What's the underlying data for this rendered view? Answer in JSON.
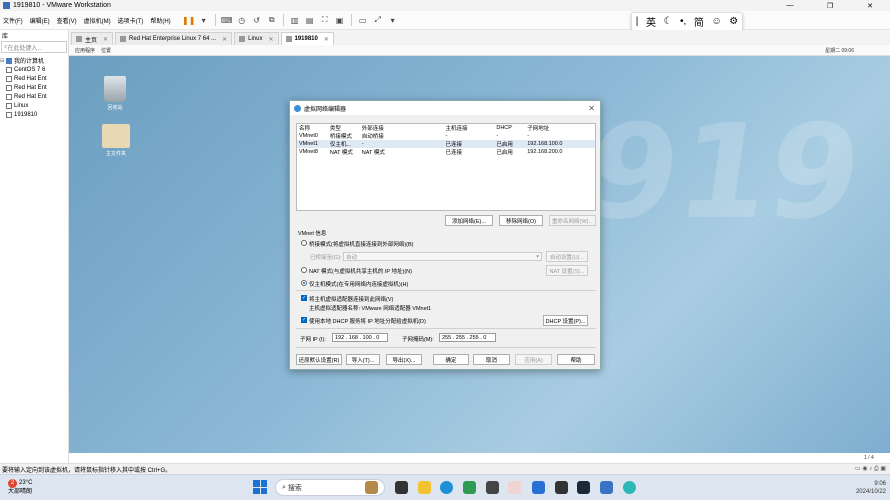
{
  "window": {
    "title": "1919810 - VMware Workstation",
    "controls": [
      "—",
      "❐",
      "✕"
    ]
  },
  "menu": {
    "items": [
      "文件(F)",
      "编辑(E)",
      "查看(V)",
      "虚拟机(M)",
      "选项卡(T)",
      "帮助(H)"
    ]
  },
  "ime": {
    "mode": "英",
    "simplified": "简"
  },
  "library": {
    "header": "库",
    "search_placeholder": "在此处键入...",
    "root": "我的计算机",
    "vms": [
      "CentOS 7 6",
      "Red Hat Ent",
      "Red Hat Ent",
      "Red Hat Ent",
      "Linux",
      "1919810"
    ]
  },
  "tabs": [
    {
      "label": "主页"
    },
    {
      "label": "Red Hat Enterprise Linux 7 64 ..."
    },
    {
      "label": "Linux"
    },
    {
      "label": "1919810"
    }
  ],
  "guestbar": {
    "apps": "应用程序",
    "places": "位置",
    "clock": "星期二 09:06"
  },
  "desktop": {
    "trash": "回收站",
    "home": "主文件夹",
    "watermark": "1919"
  },
  "dialog": {
    "title": "虚拟网络编辑器",
    "columns": [
      "名称",
      "类型",
      "外部连接",
      "主机连接",
      "DHCP",
      "子网地址"
    ],
    "rows": [
      [
        "VMnet0",
        "桥接模式",
        "自动桥接",
        "-",
        "-",
        "-"
      ],
      [
        "VMnet1",
        "仅主机...",
        "-",
        "已连接",
        "已启用",
        "192.168.100.0"
      ],
      [
        "VMnet8",
        "NAT 模式",
        "NAT 模式",
        "已连接",
        "已启用",
        "192.168.200.0"
      ]
    ],
    "add_network": "添加网络(E)...",
    "remove_network": "移除网络(O)",
    "rename_network": "重命名网络(W)...",
    "vmnet_info": "VMnet 信息",
    "bridged": "桥接模式(将虚拟机直接连接到外部网络)(B)",
    "bridged_to_label": "已桥接至(G):",
    "bridged_to_value": "自动",
    "auto_settings": "自动设置(U)...",
    "nat": "NAT 模式(与虚拟机共享主机的 IP 地址)(N)",
    "nat_settings": "NAT 设置(S)...",
    "host_only": "仅主机模式(在专用网络内连接虚拟机)(H)",
    "connect_adapter": "将主机虚拟适配器连接到此网络(V)",
    "adapter_name": "主机虚拟适配器名称: VMware 网络适配器 VMnet1",
    "use_dhcp": "使用本地 DHCP 服务将 IP 地址分配给虚拟机(D)",
    "dhcp_settings": "DHCP 设置(P)...",
    "subnet_ip_label": "子网 IP (I):",
    "subnet_ip": "192 . 168 . 100 . 0",
    "subnet_mask_label": "子网掩码(M):",
    "subnet_mask": "255 . 255 . 255 . 0",
    "restore_defaults": "还原默认设置(R)",
    "import": "导入(T)...",
    "export": "导出(X)...",
    "ok": "确定",
    "cancel": "取消",
    "apply": "应用(A)",
    "help": "帮助"
  },
  "status": {
    "text": "要将输入定向到该虚拟机，请将鼠标指针移入其中或按 Ctrl+G。",
    "page": "1 / 4"
  },
  "taskbar": {
    "badge": "2",
    "temp": "23°C",
    "weather": "大部晴朗",
    "search": "搜索",
    "time": "9:06",
    "date": "2024/10/22"
  }
}
